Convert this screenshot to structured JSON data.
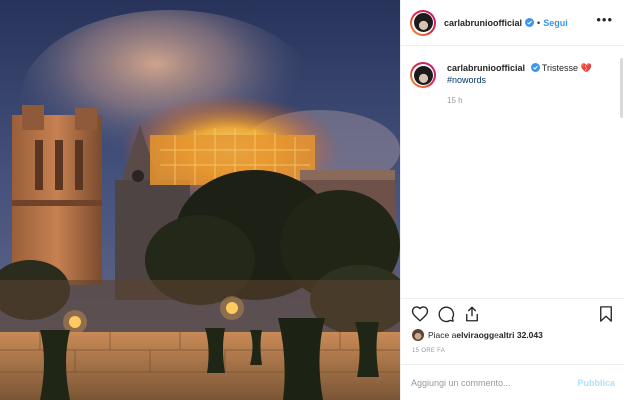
{
  "post": {
    "username": "carlabrunioofficial",
    "follow_label": "Segui",
    "dot": "•",
    "more_label": "•••",
    "caption_username": "carlabrunioofficial",
    "caption_text": "Tristesse 💔",
    "hashtag": "#nowords",
    "time_ago": "15 h",
    "likes_prefix": "Piace a ",
    "likes_user": "elviraogg",
    "likes_middle": " e ",
    "likes_rest": "altri 32.043",
    "date_label": "15 ORE FA",
    "comment_placeholder": "Aggiungi un commento...",
    "publish_label": "Pubblica"
  },
  "colors": {
    "accent": "#3897f0",
    "publish_disabled": "#b2dffc",
    "verified": "#3897f0"
  },
  "icons": [
    "verified-badge-icon",
    "more-options-icon",
    "heart-icon",
    "comment-icon",
    "share-icon",
    "bookmark-icon"
  ]
}
